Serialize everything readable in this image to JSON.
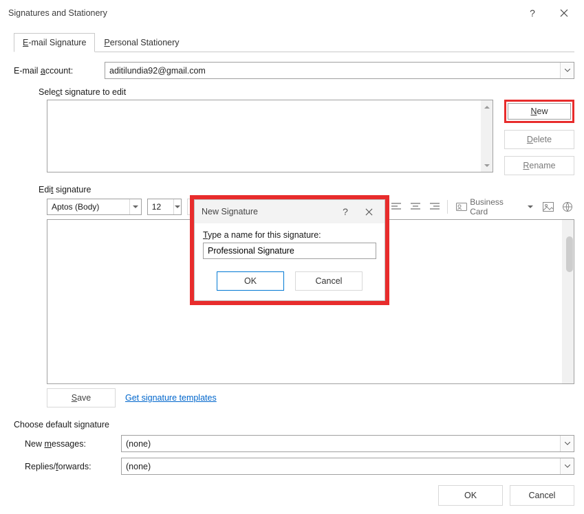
{
  "window": {
    "title": "Signatures and Stationery",
    "help_icon": "?",
    "close_icon": "✕"
  },
  "tabs": {
    "active": "E-mail Signature",
    "items": [
      "E-mail Signature",
      "Personal Stationery"
    ]
  },
  "account": {
    "label": "E-mail account:",
    "value": "aditilundia92@gmail.com"
  },
  "section_select": {
    "label": "Select signature to edit",
    "items": []
  },
  "side_buttons": {
    "new": "New",
    "delete": "Delete",
    "rename": "Rename"
  },
  "section_edit": {
    "label": "Edit signature",
    "font_name": "Aptos (Body)",
    "font_size": "12",
    "business_card": "Business Card",
    "save": "Save",
    "templates_link": "Get signature templates"
  },
  "defaults": {
    "label": "Choose default signature",
    "new_messages_label": "New messages:",
    "new_messages_value": "(none)",
    "replies_label": "Replies/forwards:",
    "replies_value": "(none)"
  },
  "footer": {
    "ok": "OK",
    "cancel": "Cancel"
  },
  "modal": {
    "title": "New Signature",
    "help_icon": "?",
    "close_icon": "✕",
    "prompt": "Type a name for this signature:",
    "value": "Professional Signature",
    "ok": "OK",
    "cancel": "Cancel"
  }
}
